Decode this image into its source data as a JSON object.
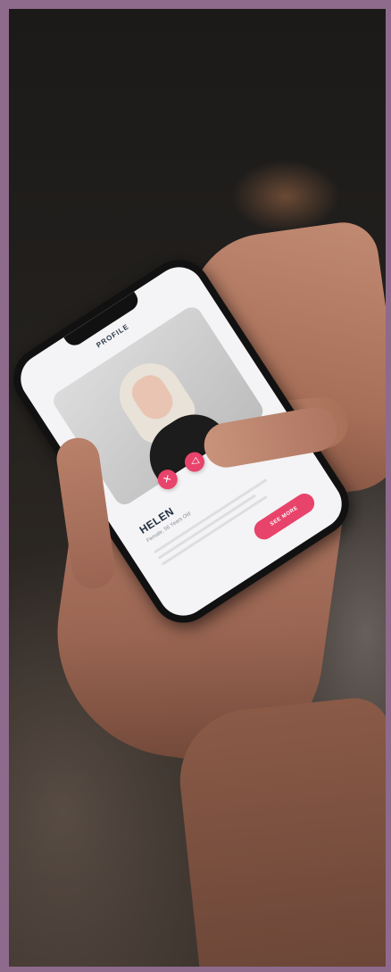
{
  "app": {
    "screen_title": "PROFILE",
    "profile_name": "HELEN",
    "profile_subtitle": "Female, 56 Years Old",
    "see_more_label": "SEE MORE"
  },
  "actions": [
    {
      "icon": "close-icon",
      "glyph": "✕"
    },
    {
      "icon": "send-icon",
      "glyph": "◁"
    },
    {
      "icon": "heart-icon",
      "glyph": "♡"
    }
  ],
  "colors": {
    "frame": "#8e6b8c",
    "accent": "#e8436a",
    "screen": "#f4f3f5",
    "name_text": "#1f2d3d"
  }
}
